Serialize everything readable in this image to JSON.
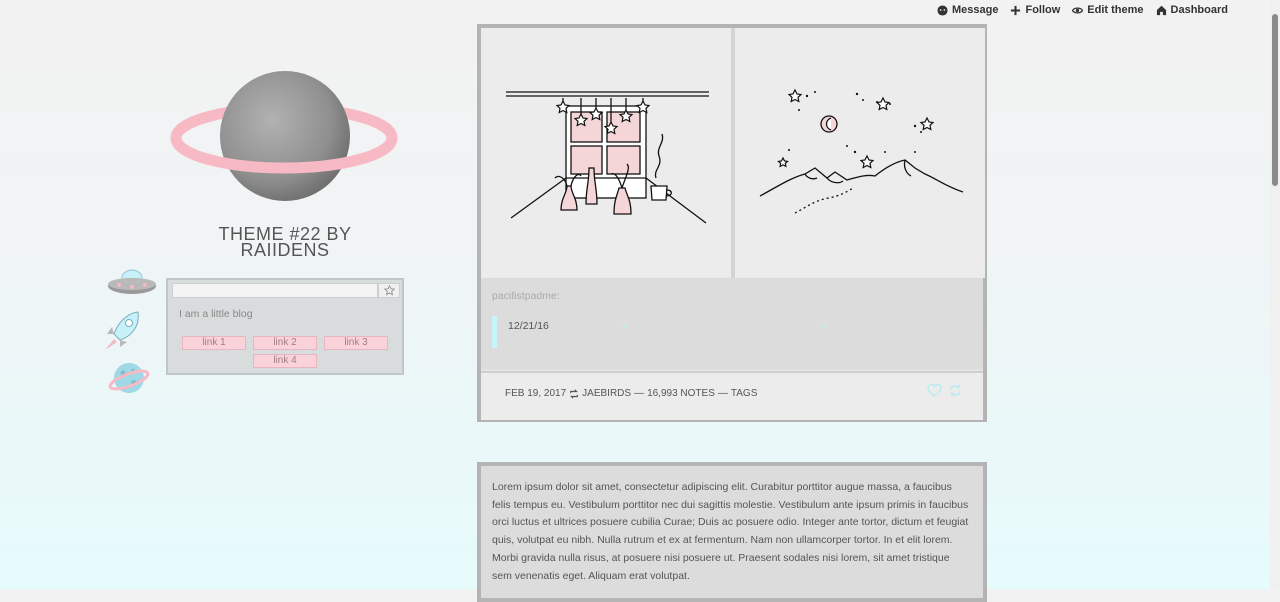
{
  "topnav": {
    "items": [
      {
        "label": "Message",
        "icon": "message-icon"
      },
      {
        "label": "Follow",
        "icon": "plus-icon"
      },
      {
        "label": "Edit theme",
        "icon": "eye-icon"
      },
      {
        "label": "Dashboard",
        "icon": "home-icon"
      }
    ]
  },
  "sidebar": {
    "title_line1": "THEME #22 BY",
    "title_line2": "RAIIDENS",
    "description": "I am a little blog",
    "links": [
      "link 1",
      "link 2",
      "link 3",
      "link 4"
    ],
    "icons": [
      "ufo-icon",
      "rocket-icon",
      "planet-icon"
    ]
  },
  "post1": {
    "username": "pacifistpadme:",
    "quote": "12/21/16",
    "date": "FEB 19, 2017",
    "reblogged_from": "JAEBIRDS",
    "notes": "16,993 NOTES",
    "tags_label": "TAGS"
  },
  "post2": {
    "text": "Lorem ipsum dolor sit amet, consectetur adipiscing elit. Curabitur porttitor augue massa, a faucibus felis tempus eu. Vestibulum porttitor nec dui sagittis molestie. Vestibulum ante ipsum primis in faucibus orci luctus et ultrices posuere cubilia Curae; Duis ac posuere odio. Integer ante tortor, dictum et feugiat quis, volutpat eu nibh. Nulla rutrum et ex at fermentum. Nam non ullamcorper tortor. In et elit lorem. Morbi gravida nulla risus, at posuere nisi posuere ut. Praesent sodales nisi lorem, sit amet tristique sem venenatis eget. Aliquam erat volutpat."
  },
  "colors": {
    "accent_pink": "#f9d3d9",
    "accent_cyan": "#c7f5fa",
    "frame_gray": "#b4b4b4"
  }
}
